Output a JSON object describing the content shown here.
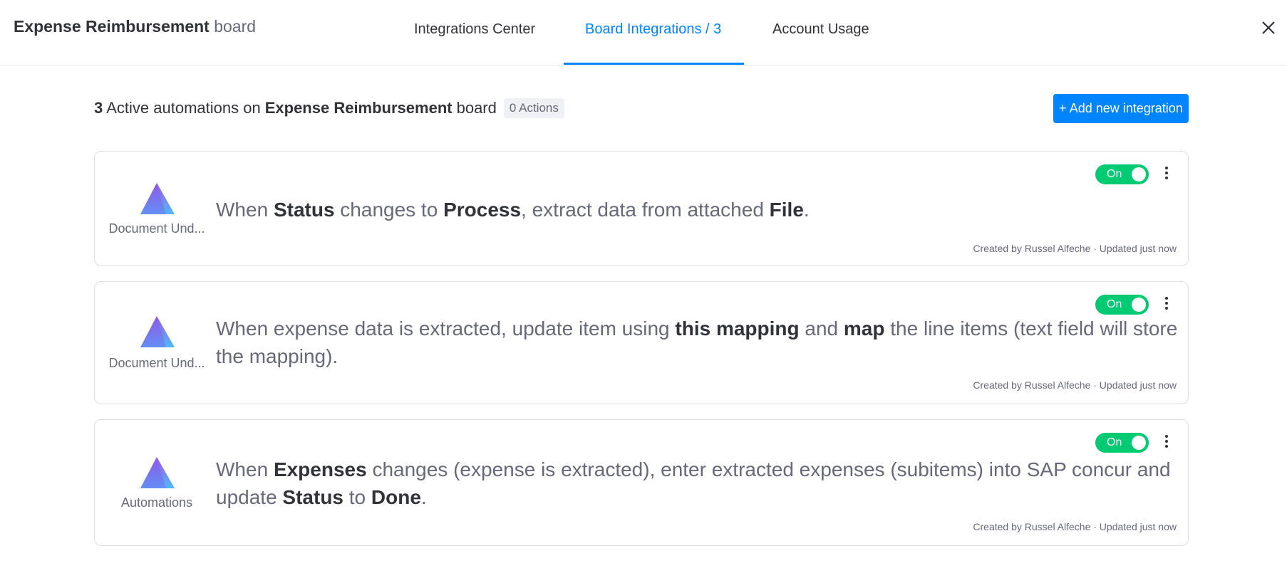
{
  "header": {
    "board_name": "Expense Reimbursement",
    "board_suffix": "board",
    "tabs": [
      {
        "label": "Integrations Center"
      },
      {
        "label": "Board Integrations / 3"
      },
      {
        "label": "Account Usage"
      }
    ],
    "active_tab": "Board Integrations / 3"
  },
  "summary": {
    "count": "3",
    "text": "Active automations on",
    "board_name": "Expense Reimbursement",
    "board_suffix": "board",
    "actions_badge": "0 Actions",
    "add_button": "+ Add new integration"
  },
  "cards": [
    {
      "app_name": "Document Und...",
      "toggle_label": "On",
      "sentence": [
        {
          "t": "When ",
          "b": false
        },
        {
          "t": "Status",
          "b": true
        },
        {
          "t": " changes to ",
          "b": false
        },
        {
          "t": "Process",
          "b": true
        },
        {
          "t": ", extract data from attached ",
          "b": false
        },
        {
          "t": "File",
          "b": true
        },
        {
          "t": ".",
          "b": false
        }
      ],
      "meta": "Created by Russel Alfeche · Updated just now"
    },
    {
      "app_name": "Document Und...",
      "toggle_label": "On",
      "sentence": [
        {
          "t": "When expense data is extracted, update item using ",
          "b": false
        },
        {
          "t": "this mapping",
          "b": true
        },
        {
          "t": " and ",
          "b": false
        },
        {
          "t": "map",
          "b": true
        },
        {
          "t": " the line items (text field will store the mapping).",
          "b": false
        }
      ],
      "meta": "Created by Russel Alfeche · Updated just now"
    },
    {
      "app_name": "Automations",
      "toggle_label": "On",
      "sentence": [
        {
          "t": "When ",
          "b": false
        },
        {
          "t": "Expenses",
          "b": true
        },
        {
          "t": " changes (expense is extracted), enter extracted expenses (subitems) into SAP concur and update ",
          "b": false
        },
        {
          "t": "Status",
          "b": true
        },
        {
          "t": " to ",
          "b": false
        },
        {
          "t": "Done",
          "b": true
        },
        {
          "t": ".",
          "b": false
        }
      ],
      "meta": "Created by Russel Alfeche · Updated just now"
    }
  ],
  "icons": {
    "close": "close-icon",
    "app_logo": "monday-triangle-logo-icon",
    "menu": "kebab-menu-icon"
  },
  "colors": {
    "accent": "#0085ff",
    "toggle_on": "#00ca72",
    "logo_gradient_top": "#a358df",
    "logo_gradient_bottom": "#4fb9f7"
  }
}
